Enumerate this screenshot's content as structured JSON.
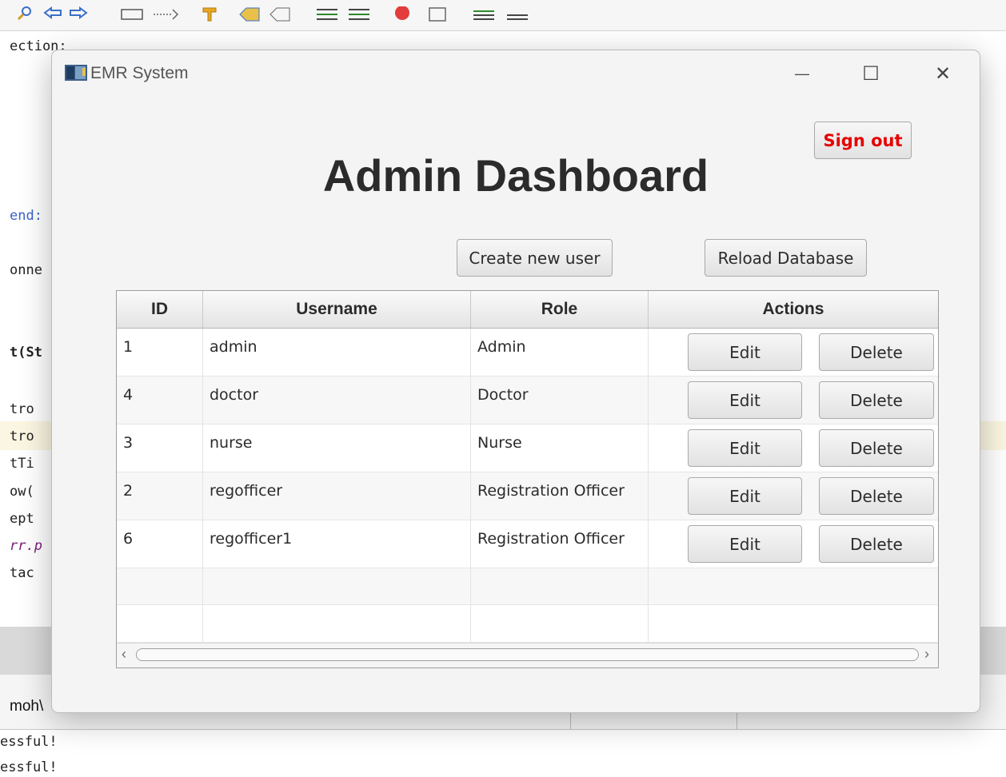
{
  "ide": {
    "code_lines": [
      "ection:",
      "end:",
      "onne",
      "t(St",
      "tro",
      "tro",
      "tTi",
      "ow(",
      "ept",
      "rr.p",
      "tac"
    ],
    "output_path": "moh\\",
    "output_lines": [
      "essful!",
      "essful!"
    ]
  },
  "window": {
    "title": "EMR System",
    "minimize_glyph": "—",
    "maximize_glyph": "☐",
    "close_glyph": "✕"
  },
  "dashboard": {
    "title": "Admin Dashboard",
    "sign_out_label": "Sign out",
    "create_user_label": "Create new user",
    "reload_label": "Reload Database"
  },
  "table": {
    "columns": [
      "ID",
      "Username",
      "Role",
      "Actions"
    ],
    "rows": [
      {
        "id": "1",
        "username": "admin",
        "role": "Admin",
        "edit": "Edit",
        "delete": "Delete"
      },
      {
        "id": "4",
        "username": "doctor",
        "role": "Doctor",
        "edit": "Edit",
        "delete": "Delete"
      },
      {
        "id": "3",
        "username": "nurse",
        "role": "Nurse",
        "edit": "Edit",
        "delete": "Delete"
      },
      {
        "id": "2",
        "username": "regofficer",
        "role": "Registration Officer",
        "edit": "Edit",
        "delete": "Delete"
      },
      {
        "id": "6",
        "username": "regofficer1",
        "role": "Registration Officer",
        "edit": "Edit",
        "delete": "Delete"
      }
    ],
    "scroll_left_glyph": "‹",
    "scroll_right_glyph": "›"
  },
  "colors": {
    "sign_out_text": "#e60000",
    "title_text": "#2b2b2b"
  }
}
